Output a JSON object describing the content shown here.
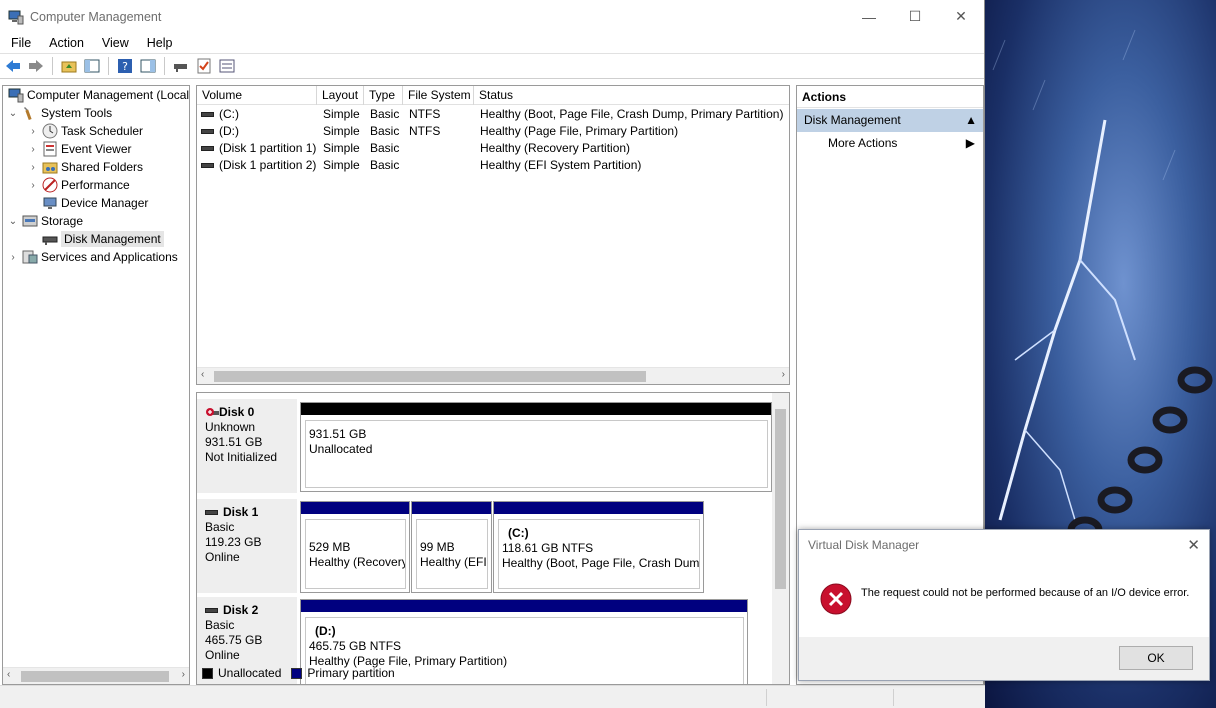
{
  "window": {
    "title": "Computer Management"
  },
  "menu": [
    "File",
    "Action",
    "View",
    "Help"
  ],
  "tree": {
    "root": "Computer Management (Local",
    "system_tools": "System Tools",
    "task_scheduler": "Task Scheduler",
    "event_viewer": "Event Viewer",
    "shared_folders": "Shared Folders",
    "performance": "Performance",
    "device_manager": "Device Manager",
    "storage": "Storage",
    "disk_management": "Disk Management",
    "services": "Services and Applications"
  },
  "volumes": {
    "headers": [
      "Volume",
      "Layout",
      "Type",
      "File System",
      "Status"
    ],
    "rows": [
      {
        "volume": "(C:)",
        "layout": "Simple",
        "type": "Basic",
        "fs": "NTFS",
        "status": "Healthy (Boot, Page File, Crash Dump, Primary Partition)"
      },
      {
        "volume": "(D:)",
        "layout": "Simple",
        "type": "Basic",
        "fs": "NTFS",
        "status": "Healthy (Page File, Primary Partition)"
      },
      {
        "volume": "(Disk 1 partition 1)",
        "layout": "Simple",
        "type": "Basic",
        "fs": "",
        "status": "Healthy (Recovery Partition)"
      },
      {
        "volume": "(Disk 1 partition 2)",
        "layout": "Simple",
        "type": "Basic",
        "fs": "",
        "status": "Healthy (EFI System Partition)"
      }
    ]
  },
  "disks": {
    "disk0": {
      "name": "Disk 0",
      "kind": "Unknown",
      "size": "931.51 GB",
      "state": "Not Initialized",
      "part": {
        "line1": "931.51 GB",
        "line2": "Unallocated"
      }
    },
    "disk1": {
      "name": "Disk 1",
      "kind": "Basic",
      "size": "119.23 GB",
      "state": "Online",
      "p1": {
        "line1": "529 MB",
        "line2": "Healthy (Recovery"
      },
      "p2": {
        "line1": "99 MB",
        "line2": "Healthy (EFI"
      },
      "p3": {
        "title": "(C:)",
        "line1": "118.61 GB NTFS",
        "line2": "Healthy (Boot, Page File, Crash Dum"
      }
    },
    "disk2": {
      "name": "Disk 2",
      "kind": "Basic",
      "size": "465.75 GB",
      "state": "Online",
      "p1": {
        "title": "(D:)",
        "line1": "465.75 GB NTFS",
        "line2": "Healthy (Page File, Primary Partition)"
      }
    }
  },
  "legend": {
    "unallocated": "Unallocated",
    "primary": "Primary partition"
  },
  "actions": {
    "header": "Actions",
    "section": "Disk Management",
    "more": "More Actions"
  },
  "dialog": {
    "title": "Virtual Disk Manager",
    "message": "The request could not be performed because of an I/O device error.",
    "ok": "OK"
  },
  "colors": {
    "primary_partition": "#00007f",
    "unallocated": "#000000",
    "selection": "#bfd1e5"
  }
}
